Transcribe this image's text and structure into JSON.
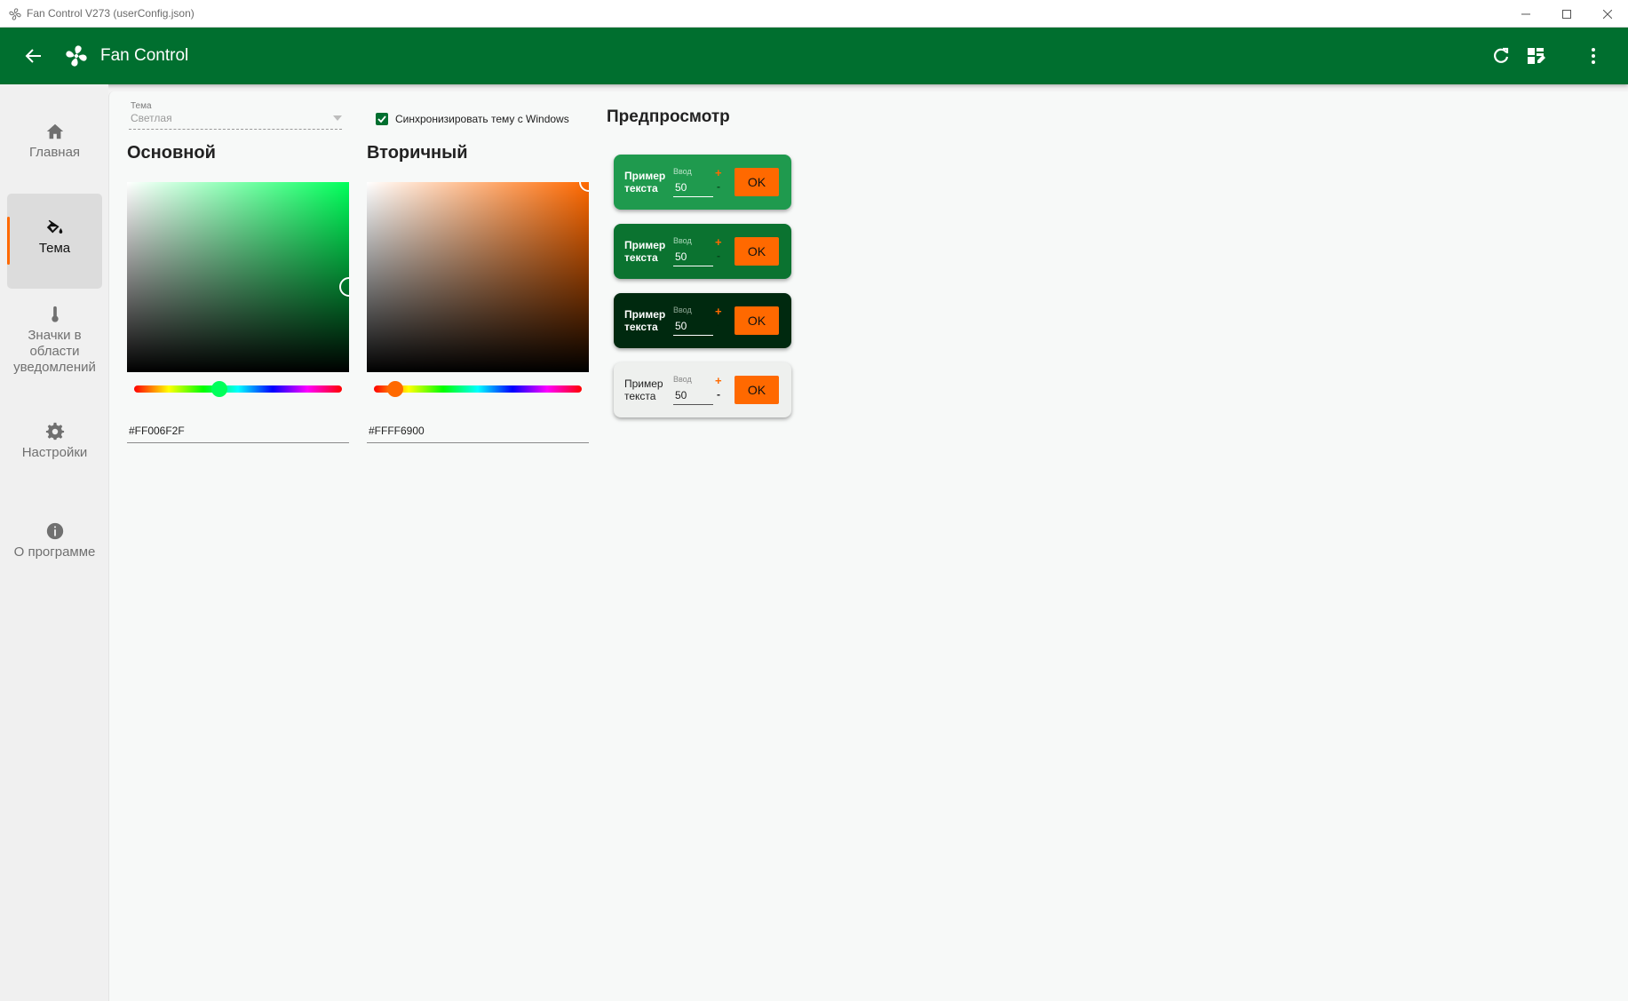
{
  "window": {
    "title": "Fan Control V273 (userConfig.json)"
  },
  "appbar": {
    "title": "Fan Control",
    "color": "#006f2f"
  },
  "sidebar": {
    "items": [
      {
        "label": "Главная",
        "icon": "home-icon",
        "active": false
      },
      {
        "label": "Тема",
        "icon": "paint-bucket-icon",
        "active": true
      },
      {
        "label": "Значки в области уведомлений",
        "icon": "thermometer-icon",
        "active": false
      },
      {
        "label": "Настройки",
        "icon": "gear-icon",
        "active": false
      },
      {
        "label": "О программе",
        "icon": "info-icon",
        "active": false
      }
    ]
  },
  "theme": {
    "caption": "Тема",
    "value": "Светлая",
    "sync_label": "Синхронизировать тему с Windows",
    "sync_checked": true
  },
  "primary": {
    "title": "Основной",
    "hex": "#FF006F2F",
    "hue_color": "#00ff5a"
  },
  "secondary": {
    "title": "Вторичный",
    "hex": "#FFFF6900",
    "hue_color": "#ff6900"
  },
  "preview": {
    "title": "Предпросмотр",
    "sample_text": "Пример текста",
    "input_caption": "Ввод",
    "input_value": "50",
    "plus": "+",
    "minus": "-",
    "ok_label": "OK",
    "card_colors": [
      "#1f9a4e",
      "#0b7330",
      "#00290f",
      "#eef0ee"
    ]
  }
}
